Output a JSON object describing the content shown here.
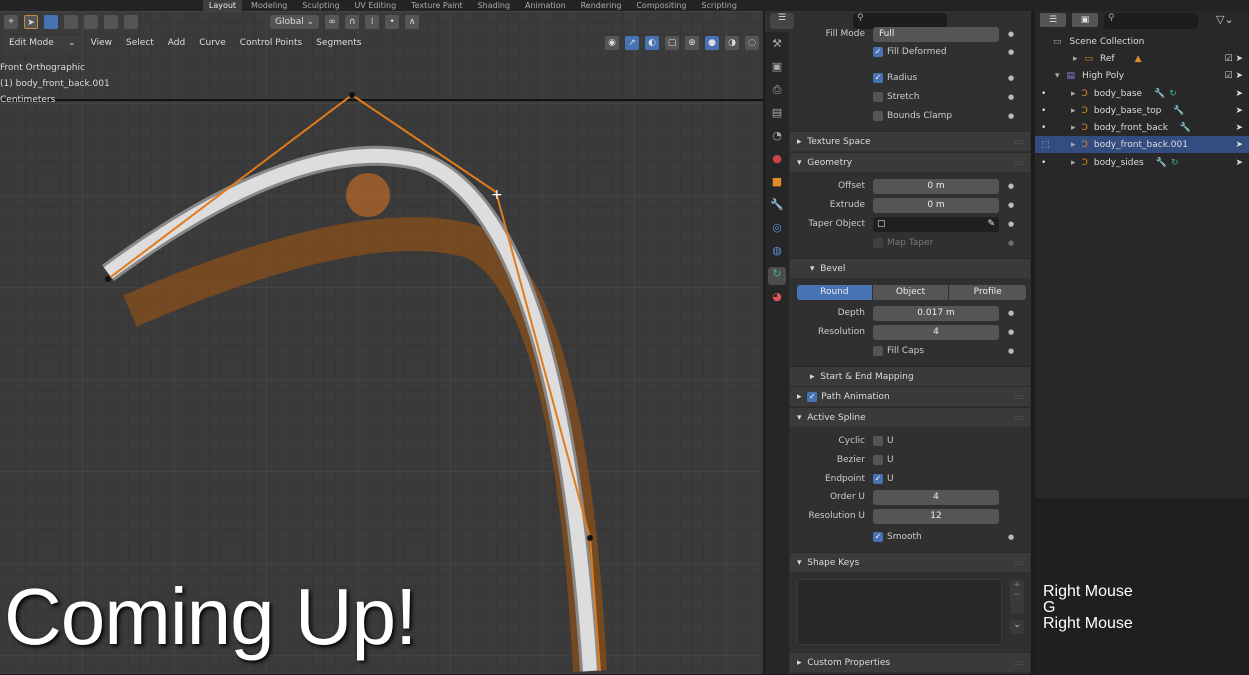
{
  "workspace_tabs": [
    "Layout",
    "Modeling",
    "Sculpting",
    "UV Editing",
    "Texture Paint",
    "Shading",
    "Animation",
    "Rendering",
    "Compositing",
    "Scripting"
  ],
  "active_tab": "Layout",
  "viewport": {
    "transform_orientation": "Global",
    "mode": "Edit Mode",
    "menus": [
      "View",
      "Select",
      "Add",
      "Curve",
      "Control Points",
      "Segments"
    ],
    "view_name": "Front Orthographic",
    "object_name": "(1) body_front_back.001",
    "units": "Centimeters",
    "overlay_text": "Coming Up!"
  },
  "properties": {
    "fill_mode_label": "Fill Mode",
    "fill_mode_value": "Full",
    "fill_deformed": {
      "label": "Fill Deformed",
      "checked": true
    },
    "radius": {
      "label": "Radius",
      "checked": true
    },
    "stretch": {
      "label": "Stretch",
      "checked": false
    },
    "bounds_clamp": {
      "label": "Bounds Clamp",
      "checked": false
    },
    "texture_space": "Texture Space",
    "geometry": "Geometry",
    "offset": {
      "label": "Offset",
      "value": "0 m"
    },
    "extrude": {
      "label": "Extrude",
      "value": "0 m"
    },
    "taper_object": {
      "label": "Taper Object"
    },
    "map_taper": {
      "label": "Map Taper",
      "checked": false
    },
    "bevel": "Bevel",
    "bevel_modes": [
      "Round",
      "Object",
      "Profile"
    ],
    "bevel_active": "Round",
    "depth": {
      "label": "Depth",
      "value": "0.017 m"
    },
    "resolution": {
      "label": "Resolution",
      "value": "4"
    },
    "fill_caps": {
      "label": "Fill Caps",
      "checked": false
    },
    "start_end_mapping": "Start & End Mapping",
    "path_animation": {
      "label": "Path Animation",
      "checked": true
    },
    "active_spline": "Active Spline",
    "cyclic": {
      "label": "Cyclic",
      "u": "U",
      "checked": false
    },
    "bezier": {
      "label": "Bezier",
      "u": "U",
      "checked": false
    },
    "endpoint": {
      "label": "Endpoint",
      "u": "U",
      "checked": true
    },
    "order_u": {
      "label": "Order U",
      "value": "4"
    },
    "resolution_u": {
      "label": "Resolution U",
      "value": "12"
    },
    "smooth": {
      "label": "Smooth",
      "checked": true
    },
    "shape_keys": "Shape Keys",
    "custom_properties": "Custom Properties"
  },
  "outliner": {
    "scene_collection": "Scene Collection",
    "items": [
      {
        "name": "Ref",
        "type": "collection"
      },
      {
        "name": "High Poly",
        "type": "collection"
      },
      {
        "name": "body_base"
      },
      {
        "name": "body_base_top"
      },
      {
        "name": "body_front_back"
      },
      {
        "name": "body_front_back.001",
        "selected": true
      },
      {
        "name": "body_sides"
      }
    ]
  },
  "keystrokes": [
    "Right Mouse",
    "G",
    "Right Mouse"
  ],
  "colors": {
    "accent": "#4772b3",
    "curve": "#e07b1a",
    "selected_row": "#334d80"
  }
}
